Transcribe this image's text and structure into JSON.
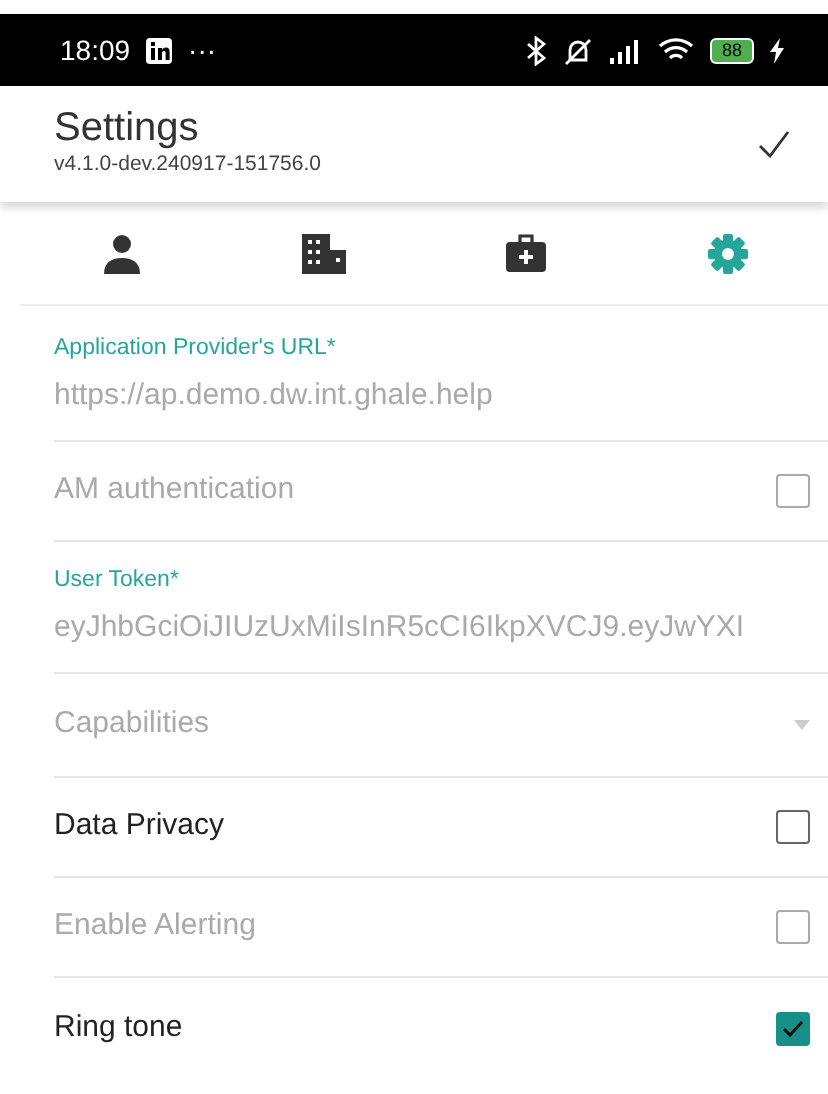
{
  "status_bar": {
    "time": "18:09",
    "more": "···",
    "battery": "88"
  },
  "header": {
    "title": "Settings",
    "subtitle": "v4.1.0-dev.240917-151756.0"
  },
  "tabs": [
    {
      "kind": "person",
      "selected": false
    },
    {
      "kind": "building",
      "selected": false
    },
    {
      "kind": "medkit",
      "selected": false
    },
    {
      "kind": "gear",
      "selected": true
    }
  ],
  "settings": [
    {
      "kind": "field",
      "label": "Application Provider's URL*",
      "value": "https://ap.demo.dw.int.ghale.help",
      "disabled": true
    },
    {
      "kind": "checkbox",
      "label": "AM authentication",
      "checked": false,
      "disabled": true
    },
    {
      "kind": "field",
      "label": "User Token*",
      "value": "eyJhbGciOiJIUzUxMiIsInR5cCI6IkpXVCJ9.eyJwYXI",
      "disabled": true
    },
    {
      "kind": "dropdown",
      "label": "Capabilities",
      "disabled": true
    },
    {
      "kind": "checkbox",
      "label": "Data Privacy",
      "checked": false,
      "disabled": false
    },
    {
      "kind": "checkbox",
      "label": "Enable Alerting",
      "checked": false,
      "disabled": true
    },
    {
      "kind": "checkbox",
      "label": "Ring tone",
      "checked": true,
      "disabled": false
    }
  ]
}
